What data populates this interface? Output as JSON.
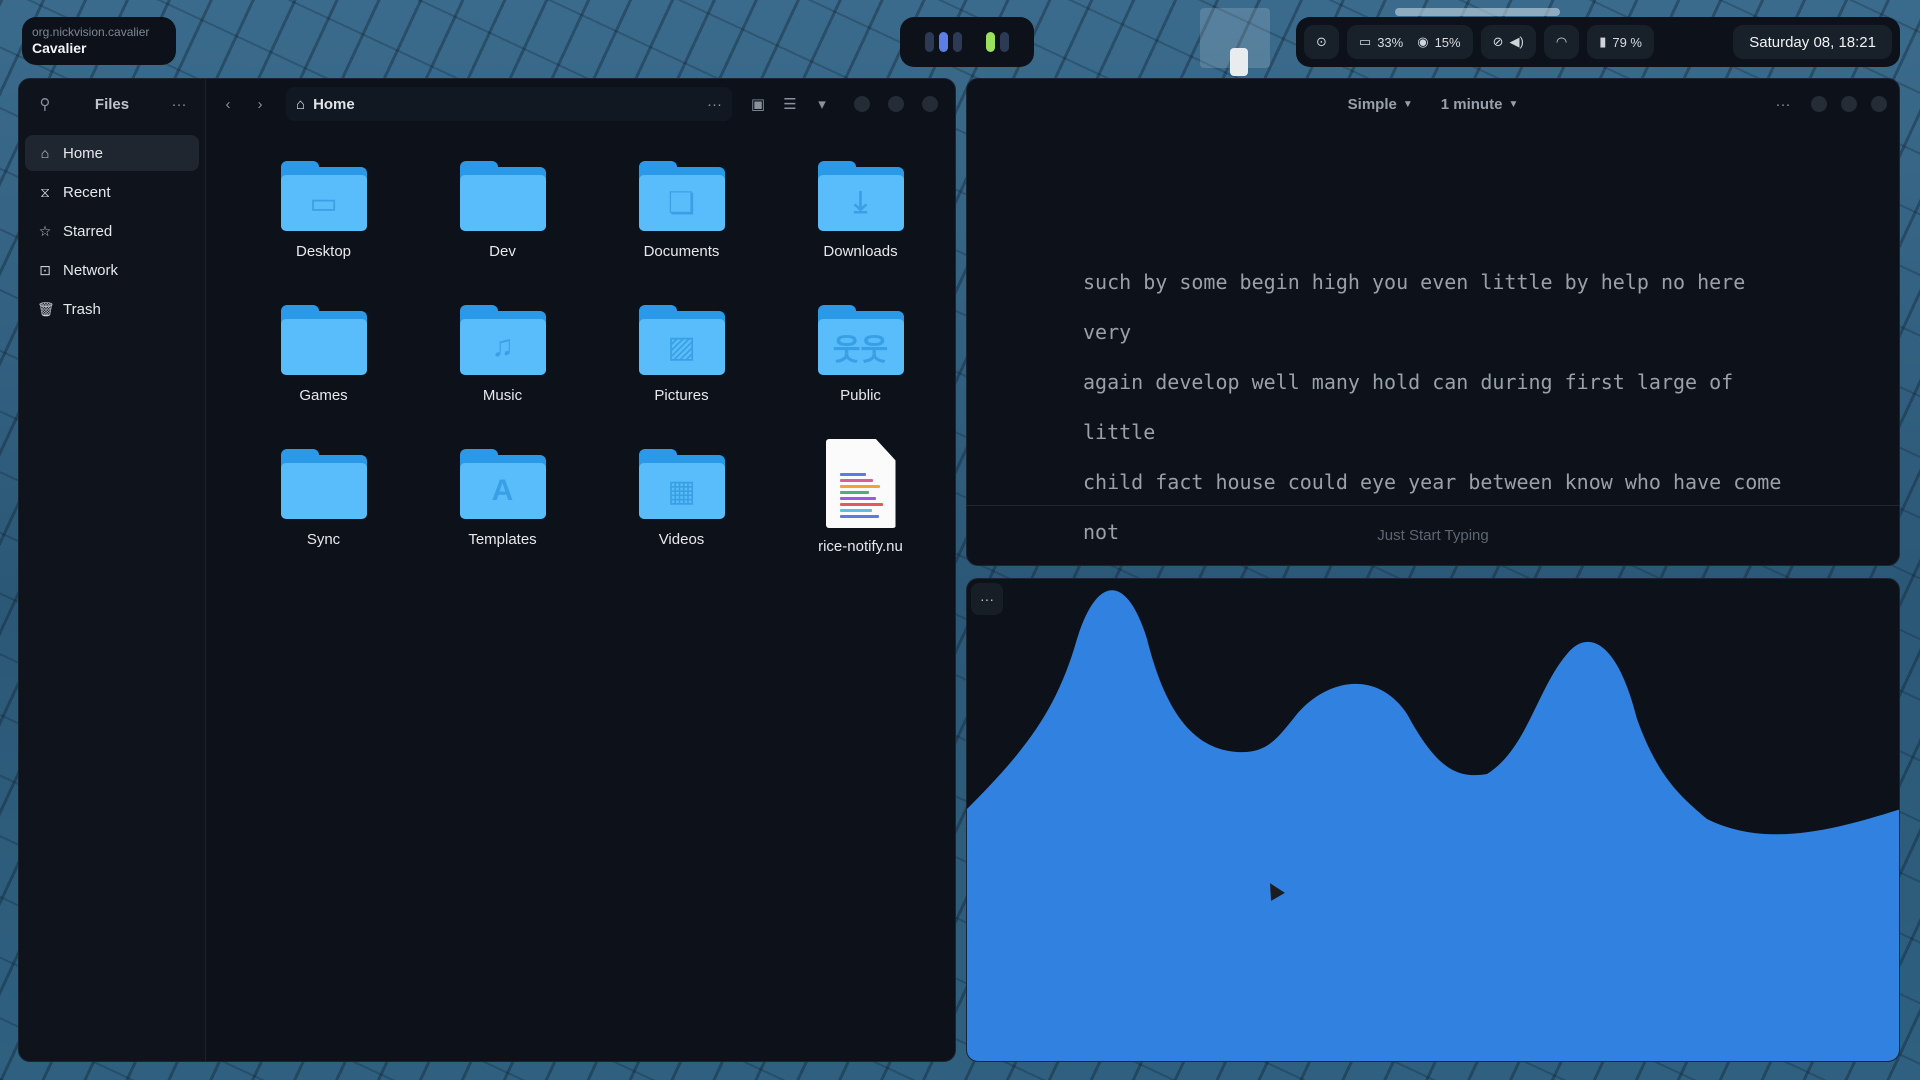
{
  "topbar": {
    "app_id": "org.nickvision.cavalier",
    "app_name": "Cavalier",
    "cpu": "33%",
    "memory": "15%",
    "battery": "79 %",
    "datetime": "Saturday 08, 18:21",
    "icons": [
      "github-icon",
      "monitor-icon",
      "cpu-icon",
      "mic-muted-icon",
      "volume-icon",
      "wifi-icon",
      "battery-icon"
    ]
  },
  "files": {
    "sidebar_title": "Files",
    "nav": [
      {
        "label": "Home",
        "icon": "home-icon"
      },
      {
        "label": "Recent",
        "icon": "clock-icon"
      },
      {
        "label": "Starred",
        "icon": "star-icon"
      },
      {
        "label": "Network",
        "icon": "network-icon"
      },
      {
        "label": "Trash",
        "icon": "trash-icon"
      }
    ],
    "path": "Home",
    "items": [
      {
        "label": "Desktop",
        "type": "folder",
        "emblem": "▭"
      },
      {
        "label": "Dev",
        "type": "folder",
        "emblem": ""
      },
      {
        "label": "Documents",
        "type": "folder",
        "emblem": "❏"
      },
      {
        "label": "Downloads",
        "type": "folder",
        "emblem": "⤓"
      },
      {
        "label": "Games",
        "type": "folder",
        "emblem": ""
      },
      {
        "label": "Music",
        "type": "folder",
        "emblem": "♫"
      },
      {
        "label": "Pictures",
        "type": "folder",
        "emblem": "▨"
      },
      {
        "label": "Public",
        "type": "folder",
        "emblem": "웃웃"
      },
      {
        "label": "Sync",
        "type": "folder",
        "emblem": ""
      },
      {
        "label": "Templates",
        "type": "folder",
        "emblem": "A"
      },
      {
        "label": "Videos",
        "type": "folder",
        "emblem": "▦"
      },
      {
        "label": "rice-notify.nu",
        "type": "file",
        "emblem": ""
      }
    ]
  },
  "typing": {
    "mode": "Simple",
    "duration": "1 minute",
    "lines": [
      "such by some begin high you even little by help no here very",
      "again develop well many hold can during first large of little",
      "child fact house could eye year between know who have come not"
    ],
    "footer": "Just Start Typing"
  },
  "visualizer": {
    "menu_label": "···",
    "color": "#3182e0"
  },
  "colors": {
    "accent": "#3182e0",
    "folder_front": "#59bdfb",
    "folder_back": "#2a9ae8",
    "window_bg": "#0d121a"
  }
}
